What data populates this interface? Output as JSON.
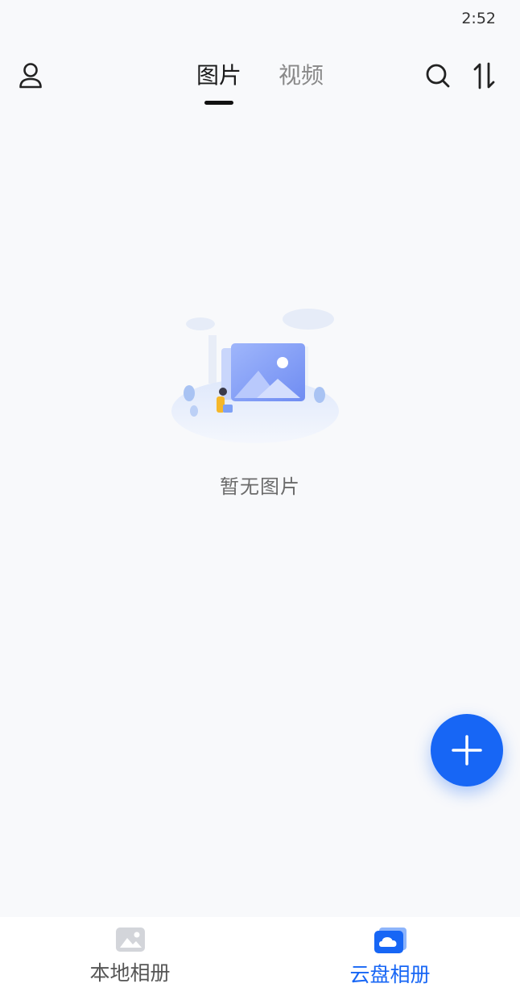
{
  "status_bar": {
    "time": "2:52"
  },
  "top_bar": {
    "tabs": [
      {
        "label": "图片",
        "active": true
      },
      {
        "label": "视频",
        "active": false
      }
    ],
    "icons": [
      "profile-icon",
      "search-icon",
      "sort-icon"
    ]
  },
  "empty_state": {
    "message": "暂无图片"
  },
  "fab": {
    "icon": "plus-icon"
  },
  "bottom_nav": {
    "items": [
      {
        "label": "本地相册",
        "icon": "local-album-icon",
        "active": false
      },
      {
        "label": "云盘相册",
        "icon": "cloud-album-icon",
        "active": true
      }
    ]
  },
  "colors": {
    "accent": "#1766f5",
    "background": "#f8f9fb"
  }
}
